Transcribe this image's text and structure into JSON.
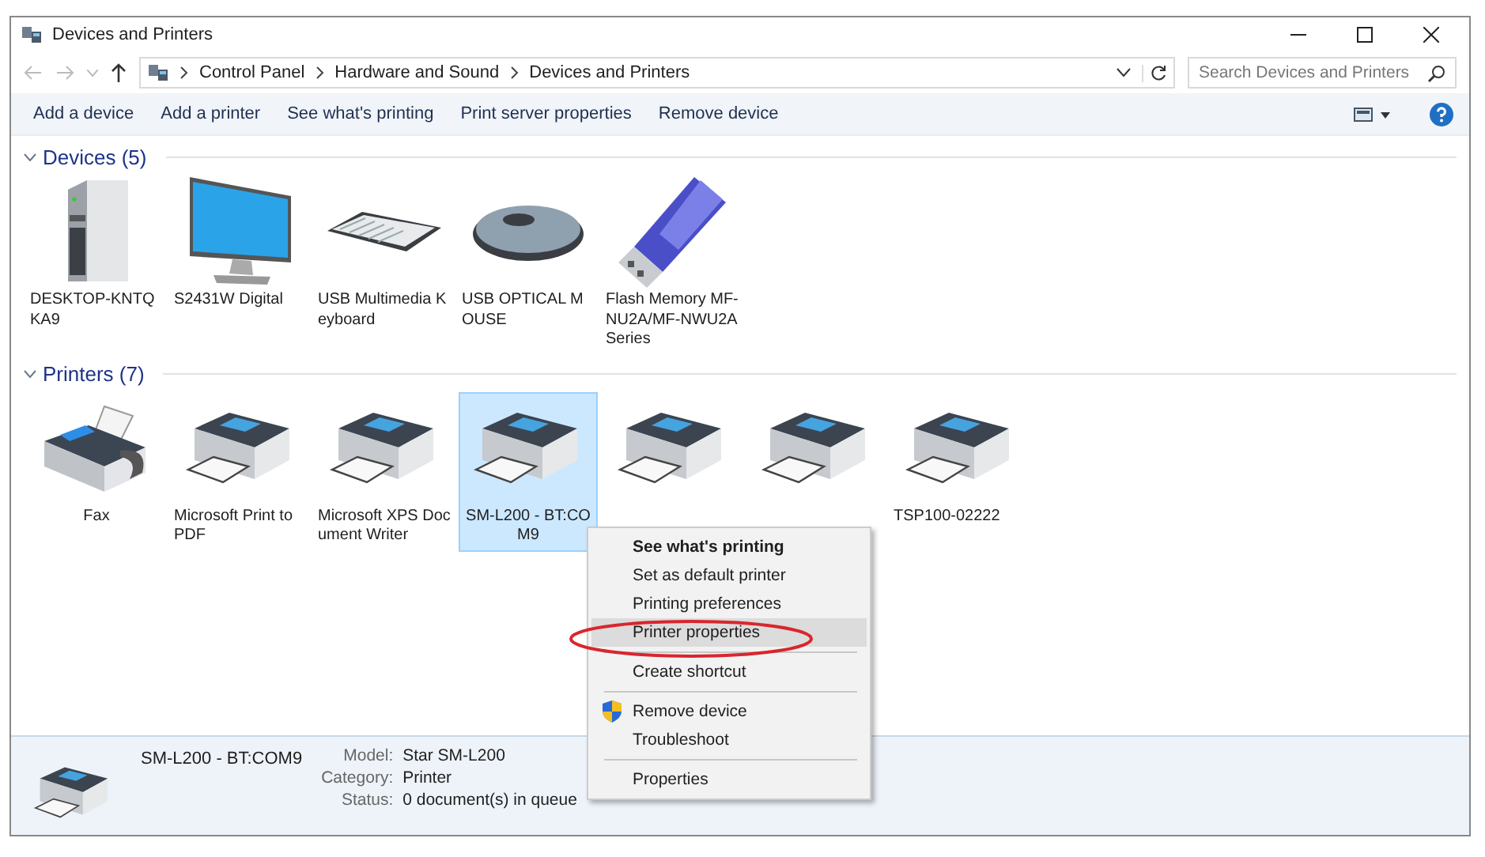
{
  "window": {
    "title": "Devices and Printers"
  },
  "address": {
    "breadcrumbs": [
      "Control Panel",
      "Hardware and Sound",
      "Devices and Printers"
    ]
  },
  "search": {
    "placeholder": "Search Devices and Printers"
  },
  "toolbar": [
    "Add a device",
    "Add a printer",
    "See what's printing",
    "Print server properties",
    "Remove device"
  ],
  "groups": [
    {
      "title": "Devices (5)",
      "expanded": true,
      "items": [
        {
          "label": "DESKTOP-KNTQKA9",
          "kind": "tower",
          "selected": false
        },
        {
          "label": "S2431W Digital",
          "kind": "monitor",
          "selected": false
        },
        {
          "label": "USB Multimedia Keyboard",
          "kind": "keyboard",
          "selected": false
        },
        {
          "label": "USB OPTICAL MOUSE",
          "kind": "mouse",
          "selected": false
        },
        {
          "label": "Flash Memory MF-NU2A/MF-NWU2A Series",
          "kind": "usb",
          "selected": false
        }
      ]
    },
    {
      "title": "Printers (7)",
      "expanded": true,
      "items": [
        {
          "label": "Fax",
          "kind": "fax",
          "selected": false
        },
        {
          "label": "Microsoft Print to PDF",
          "kind": "printer",
          "selected": false
        },
        {
          "label": "Microsoft XPS Document Writer",
          "kind": "printer",
          "selected": false
        },
        {
          "label": "SM-L200 - BT:COM9",
          "kind": "printer",
          "selected": true
        },
        {
          "kind": "printer",
          "selected": false
        },
        {
          "kind": "printer",
          "selected": false
        },
        {
          "label": "TSP100-02222",
          "kind": "printer",
          "selected": false
        }
      ]
    }
  ],
  "context_menu": {
    "items": [
      {
        "kind": "item",
        "label": "See what's printing",
        "default": true,
        "selected": false
      },
      {
        "kind": "item",
        "label": "Set as default printer",
        "default": false,
        "selected": false
      },
      {
        "kind": "item",
        "label": "Printing preferences",
        "default": false,
        "selected": false
      },
      {
        "kind": "item",
        "label": "Printer properties",
        "default": false,
        "selected": true
      },
      {
        "kind": "separator"
      },
      {
        "kind": "item",
        "label": "Create shortcut",
        "default": false,
        "selected": false
      },
      {
        "kind": "separator"
      },
      {
        "kind": "shield",
        "label": "Remove device",
        "default": false,
        "selected": false
      },
      {
        "kind": "item",
        "label": "Troubleshoot",
        "default": false,
        "selected": false
      },
      {
        "kind": "separator"
      },
      {
        "kind": "item",
        "label": "Properties",
        "default": false,
        "selected": false
      }
    ]
  },
  "details": {
    "name": "SM-L200 - BT:COM9",
    "fields": [
      {
        "label": "Model:",
        "value": "Star SM-L200"
      },
      {
        "label": "Category:",
        "value": "Printer"
      },
      {
        "label": "Status:",
        "value": "0 document(s) in queue"
      }
    ]
  }
}
